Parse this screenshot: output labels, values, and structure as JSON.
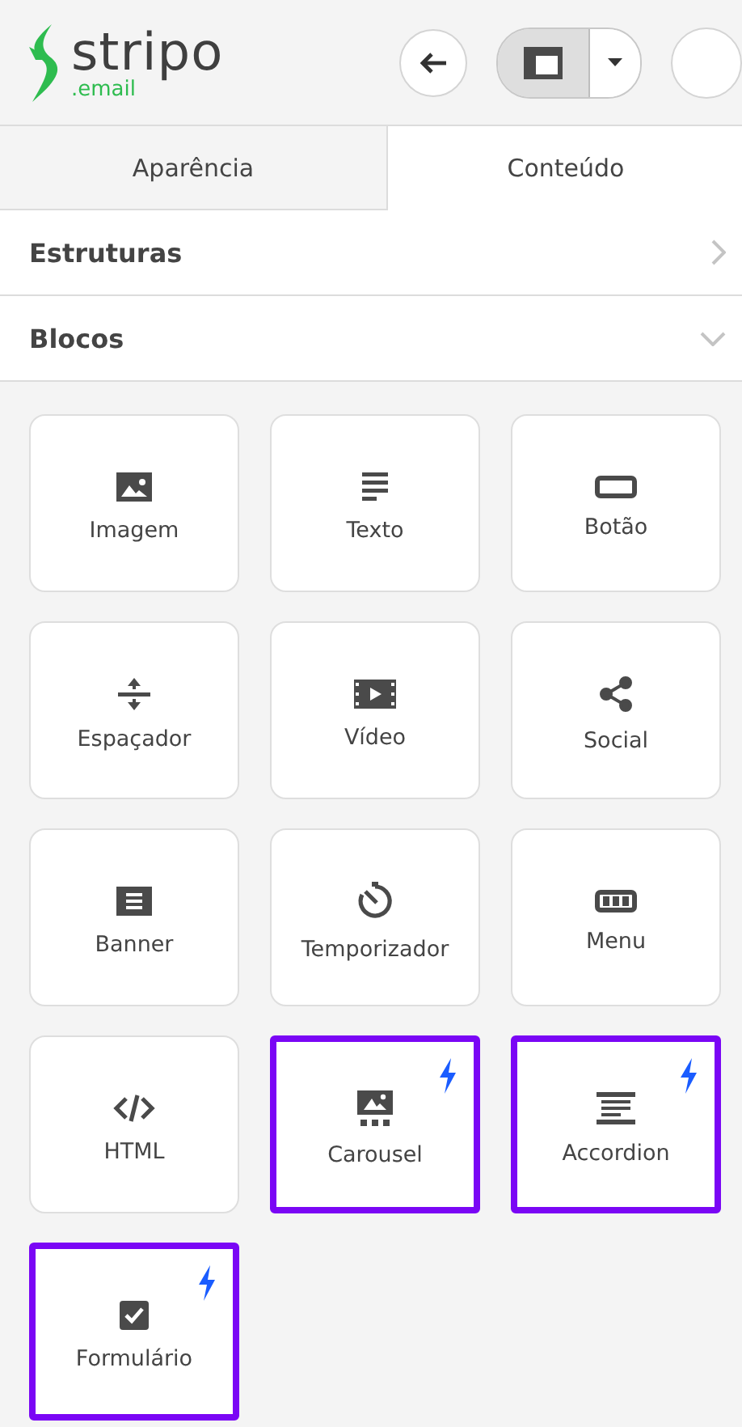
{
  "logo": {
    "name": "stripo",
    "suffix": ".email"
  },
  "tabs": [
    {
      "label": "Aparência",
      "selected": false
    },
    {
      "label": "Conteúdo",
      "selected": true
    }
  ],
  "sections": [
    {
      "title": "Estruturas",
      "expanded": false
    },
    {
      "title": "Blocos",
      "expanded": true
    }
  ],
  "blocks": [
    {
      "label": "Imagem",
      "kind": "image",
      "amp": false
    },
    {
      "label": "Texto",
      "kind": "text",
      "amp": false
    },
    {
      "label": "Botão",
      "kind": "button",
      "amp": false
    },
    {
      "label": "Espaçador",
      "kind": "spacer",
      "amp": false
    },
    {
      "label": "Vídeo",
      "kind": "video",
      "amp": false
    },
    {
      "label": "Social",
      "kind": "share",
      "amp": false
    },
    {
      "label": "Banner",
      "kind": "banner",
      "amp": false
    },
    {
      "label": "Temporizador",
      "kind": "timer",
      "amp": false
    },
    {
      "label": "Menu",
      "kind": "menu",
      "amp": false
    },
    {
      "label": "HTML",
      "kind": "code",
      "amp": false
    },
    {
      "label": "Carousel",
      "kind": "carousel",
      "amp": true
    },
    {
      "label": "Accordion",
      "kind": "accordion",
      "amp": true
    },
    {
      "label": "Formulário",
      "kind": "form",
      "amp": true
    }
  ]
}
